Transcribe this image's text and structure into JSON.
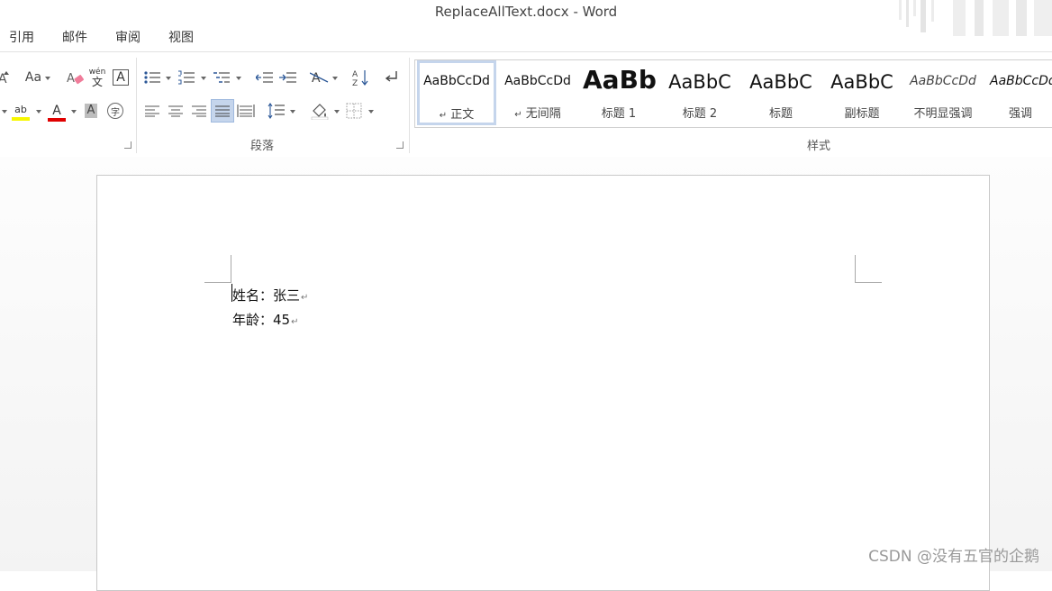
{
  "window": {
    "title": "ReplaceAllText.docx - Word"
  },
  "menu": {
    "items": [
      "引用",
      "邮件",
      "审阅",
      "视图"
    ]
  },
  "ribbon": {
    "font_size_label": "Aa",
    "phonetic_top": "wén",
    "phonetic_bottom": "文",
    "char_border_label": "A",
    "highlight_label": "ab",
    "font_color_label": "A",
    "char_shading_label": "A",
    "enclose_label": "字",
    "paragraph_group_label": "段落",
    "styles_group_label": "样式",
    "colors": {
      "highlight": "#f7f700",
      "font_color": "#e00000",
      "selected_button": "#c5d5ec"
    }
  },
  "styles": [
    {
      "preview": "AaBbCcDd",
      "name": "正文",
      "mark": "↵",
      "selected": true
    },
    {
      "preview": "AaBbCcDd",
      "name": "无间隔",
      "mark": "↵",
      "selected": false
    },
    {
      "preview": "AaBb",
      "name": "标题 1",
      "mark": "",
      "selected": false
    },
    {
      "preview": "AaBbC",
      "name": "标题 2",
      "mark": "",
      "selected": false
    },
    {
      "preview": "AaBbC",
      "name": "标题",
      "mark": "",
      "selected": false
    },
    {
      "preview": "AaBbC",
      "name": "副标题",
      "mark": "",
      "selected": false
    },
    {
      "preview": "AaBbCcDd",
      "name": "不明显强调",
      "mark": "",
      "selected": false
    },
    {
      "preview": "AaBbCcDd",
      "name": "强调",
      "mark": "",
      "selected": false
    }
  ],
  "document": {
    "lines": [
      "姓名：张三",
      "年龄：45"
    ],
    "paragraph_mark": "↵"
  },
  "watermark": "CSDN @没有五官的企鹅"
}
